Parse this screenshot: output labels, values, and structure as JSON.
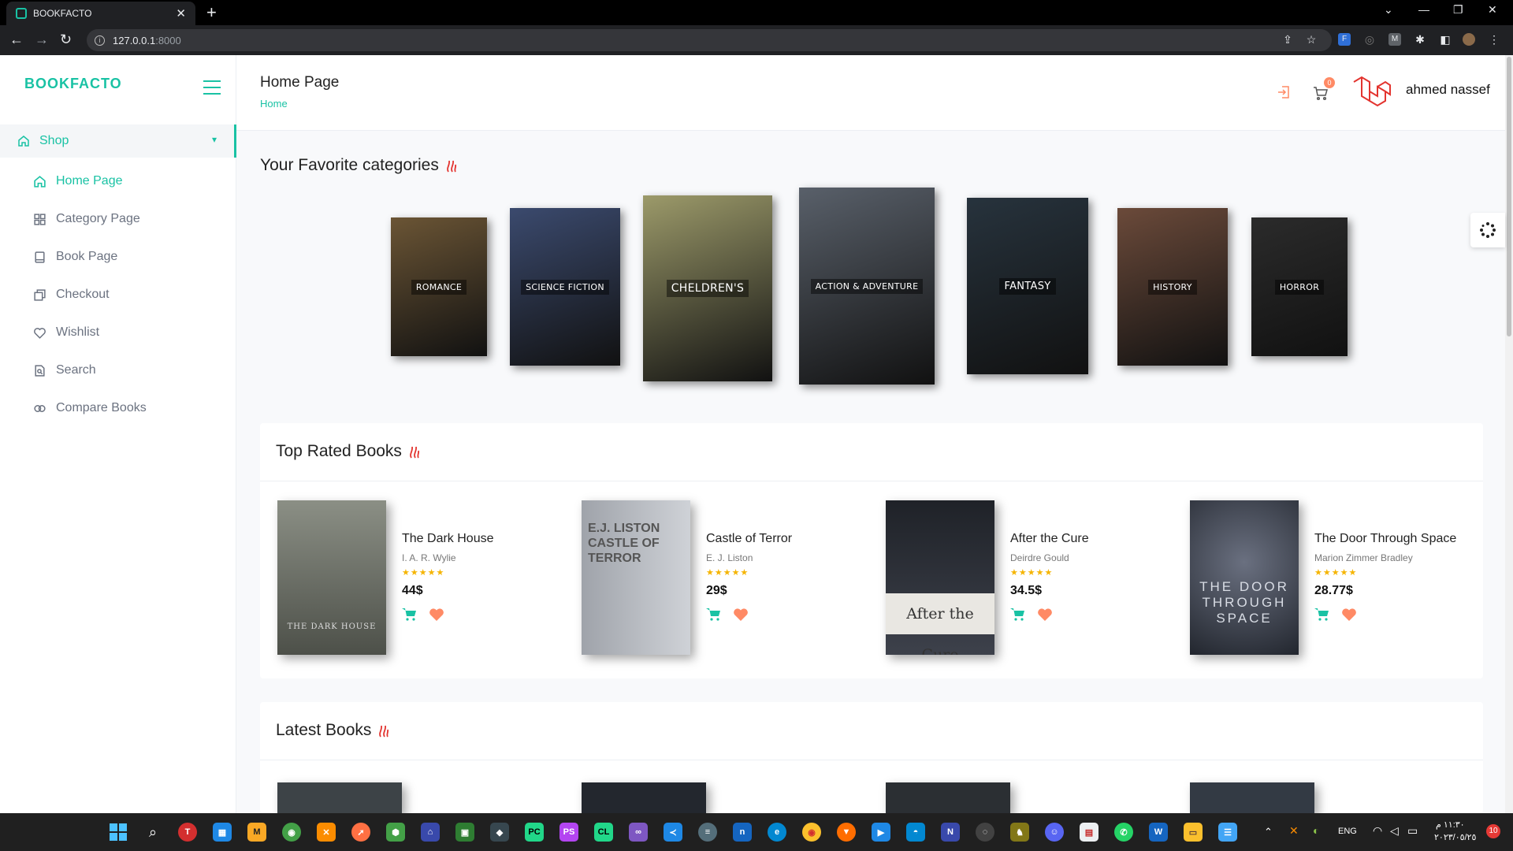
{
  "browser": {
    "tab_title": "BOOKFACTO",
    "url_host": "127.0.0.1",
    "url_port": ":8000"
  },
  "sidebar": {
    "brand": "BOOKFACTO",
    "group": "Shop",
    "items": [
      {
        "label": "Home Page",
        "icon": "home-icon"
      },
      {
        "label": "Category Page",
        "icon": "grid-icon"
      },
      {
        "label": "Book Page",
        "icon": "book-icon"
      },
      {
        "label": "Checkout",
        "icon": "checkout-icon"
      },
      {
        "label": "Wishlist",
        "icon": "heart-icon"
      },
      {
        "label": "Search",
        "icon": "search-icon"
      },
      {
        "label": "Compare Books",
        "icon": "compare-icon"
      }
    ]
  },
  "header": {
    "title": "Home Page",
    "breadcrumb": "Home",
    "cart_count": "0",
    "username": "ahmed nassef"
  },
  "favorites": {
    "heading": "Your Favorite categories",
    "categories": [
      {
        "label": "ROMANCE",
        "color": "#6b5535"
      },
      {
        "label": "SCIENCE FICTION",
        "color": "#3b4a6e"
      },
      {
        "label": "CHELDREN'S",
        "color": "#9c9a6a"
      },
      {
        "label": "ACTION & ADVENTURE",
        "color": "#59606a"
      },
      {
        "label": "FANTASY",
        "color": "#27333d"
      },
      {
        "label": "HISTORY",
        "color": "#6b4a3a"
      },
      {
        "label": "HORROR",
        "color": "#2b2b2b"
      }
    ]
  },
  "top_rated": {
    "heading": "Top Rated Books",
    "books": [
      {
        "title": "The Dark House",
        "author": "I. A. R. Wylie",
        "price": "44$",
        "rating": 5,
        "stars": "★★★★★",
        "cover_color": "#6d7066",
        "cover_text": "THE DARK HOUSE"
      },
      {
        "title": "Castle of Terror",
        "author": "E. J. Liston",
        "price": "29$",
        "rating": 5,
        "stars": "★★★★★",
        "cover_color": "#b9bcc2",
        "cover_text": "E.J. LISTON CASTLE OF TERROR"
      },
      {
        "title": "After the Cure",
        "author": "Deirdre Gould",
        "price": "34.5$",
        "rating": 5,
        "stars": "★★★★★",
        "cover_color": "#2b2e36",
        "cover_text": "After the Cure"
      },
      {
        "title": "The Door Through Space",
        "author": "Marion Zimmer Bradley",
        "price": "28.77$",
        "rating": 5,
        "stars": "★★★★★",
        "cover_color": "#3a3f4a",
        "cover_text": "THE DOOR THROUGH SPACE"
      }
    ]
  },
  "latest": {
    "heading": "Latest Books",
    "covers": [
      {
        "color": "#3d4347"
      },
      {
        "color": "#23272e"
      },
      {
        "color": "#2b2f33"
      },
      {
        "color": "#333a44"
      }
    ]
  },
  "taskbar": {
    "language": "ENG",
    "time": "١١:٣٠ م",
    "date": "٢٠٢٣/٠٥/٢٥"
  }
}
